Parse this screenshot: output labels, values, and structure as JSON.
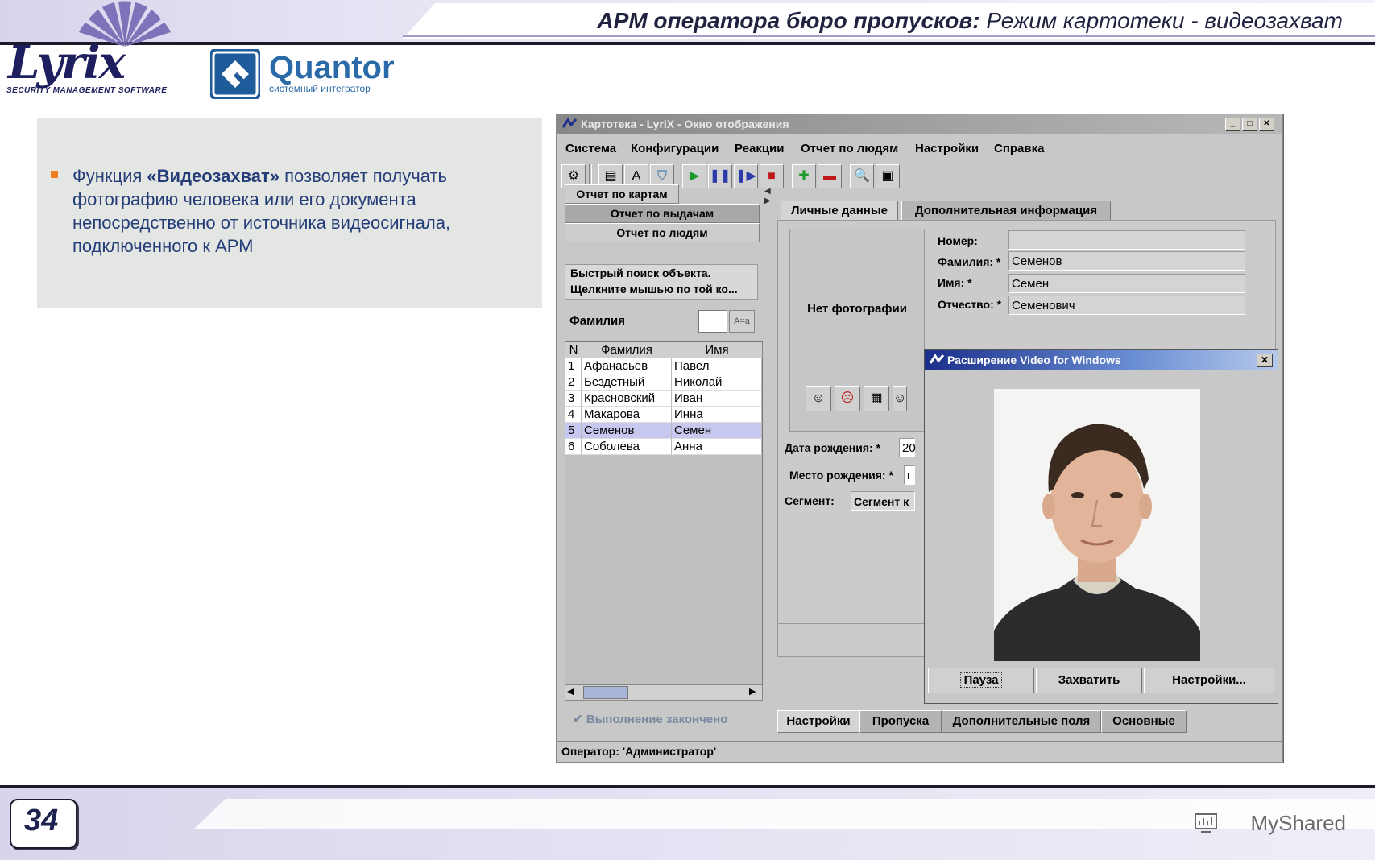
{
  "slide": {
    "title_bold": "АРМ оператора бюро пропусков:",
    "title_rest": " Режим картотеки - видеозахват",
    "logo_lyrix": "Lyrix",
    "logo_lyrix_sub": "SECURITY MANAGEMENT SOFTWARE",
    "logo_quantor": "Quantor",
    "logo_quantor_sub": "системный интегратор",
    "body_pre": "Функция ",
    "body_bold": "«Видеозахват»",
    "body_post": " позволяет получать фотографию человека или его документа непосредственно от источника видеосигнала, подключенного к АРМ",
    "page_number": "34",
    "watermark": "MyShared",
    "accent_color": "#f07c1e",
    "text_color": "#243d78"
  },
  "window": {
    "title": "Картотека - LyriX - Окно отображения",
    "controls": [
      "_",
      "□",
      "✕"
    ],
    "menu": [
      "Система",
      "Конфигурации",
      "Реакции",
      "Отчет по людям",
      "Настройки",
      "Справка"
    ],
    "toolbar_icons": [
      "tree-icon",
      "window-icon",
      "ab-icon",
      "shield-icon",
      "play-icon",
      "pause-icon",
      "step-icon",
      "stop-icon",
      "add-icon",
      "remove-icon",
      "preview-icon",
      "save-icon"
    ]
  },
  "left_panel": {
    "btn_cards": "Отчет по картам",
    "btn_issues": "Отчет по выдачам",
    "btn_people": "Отчет по людям",
    "quick_line1": "Быстрый поиск объекта.",
    "quick_line2": "Щелкните мышью по той ко...",
    "surname_label": "Фамилия",
    "az_label": "A=a",
    "grid_headers": [
      "N",
      "Фамилия",
      "Имя"
    ],
    "rows": [
      {
        "n": "1",
        "surname": "Афанасьев",
        "name": "Павел"
      },
      {
        "n": "2",
        "surname": "Бездетный",
        "name": "Николай"
      },
      {
        "n": "3",
        "surname": "Красновский",
        "name": "Иван"
      },
      {
        "n": "4",
        "surname": "Макарова",
        "name": "Инна"
      },
      {
        "n": "5",
        "surname": "Семенов",
        "name": "Семен"
      },
      {
        "n": "6",
        "surname": "Соболева",
        "name": "Анна"
      }
    ],
    "selected_row": 5,
    "status": "Выполнение закончено"
  },
  "right_panel": {
    "tab_personal": "Личные данные",
    "tab_additional": "Дополнительная информация",
    "no_photo": "Нет фотографии",
    "number_label": "Номер:",
    "number_value": "",
    "surname_label": "Фамилия: *",
    "surname_value": "Семенов",
    "name_label": "Имя: *",
    "name_value": "Семен",
    "patronymic_label": "Отчество: *",
    "patronymic_value": "Семенович",
    "birth_date_label": "Дата рождения: *",
    "birth_date_value": "20",
    "birth_place_label": "Место рождения: *",
    "birth_place_value": "г",
    "segment_label": "Сегмент:",
    "segment_value": "Сегмент к",
    "bottom_tabs": [
      "Настройки",
      "Пропуска",
      "Дополнительные поля",
      "Основные"
    ]
  },
  "video_dialog": {
    "title": "Расширение Video for Windows",
    "close": "✕",
    "btn_pause": "Пауза",
    "btn_capture": "Захватить",
    "btn_settings": "Настройки..."
  },
  "statusbar": {
    "operator": "Оператор: 'Администратор'"
  }
}
